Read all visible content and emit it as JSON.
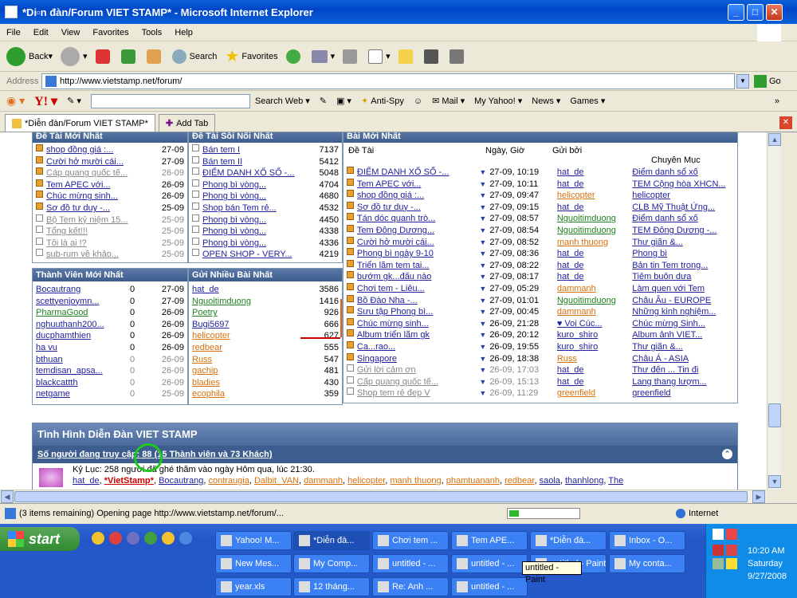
{
  "window": {
    "title": "*Di▫n đàn/Forum VIET STAMP* - Microsoft Internet Explorer"
  },
  "menu": [
    "File",
    "Edit",
    "View",
    "Favorites",
    "Tools",
    "Help"
  ],
  "toolbar": {
    "back": "Back",
    "search": "Search",
    "favorites": "Favorites"
  },
  "address": {
    "label": "Address",
    "url": "http://www.vietstamp.net/forum/",
    "go": "Go"
  },
  "yahoo": {
    "search_web": "Search Web",
    "anti_spy": "Anti-Spy",
    "mail": "Mail",
    "my_yahoo": "My Yahoo!",
    "news": "News",
    "games": "Games"
  },
  "tabs": {
    "active": "*Diễn đàn/Forum VIET STAMP*",
    "add": "Add Tab"
  },
  "panels": {
    "newest_topics": {
      "title": "Đề Tài Mới Nhất",
      "rows": [
        {
          "t": "shop đồng giá :...",
          "d": "27-09",
          "s": "o",
          "g": false
        },
        {
          "t": "Cười hở mười cái...",
          "d": "27-09",
          "s": "o",
          "g": false
        },
        {
          "t": "Cáp quang quốc tế...",
          "d": "26-09",
          "s": "o",
          "g": true
        },
        {
          "t": "Tem APEC với...",
          "d": "26-09",
          "s": "o",
          "g": false
        },
        {
          "t": "Chúc mừng sinh...",
          "d": "26-09",
          "s": "o",
          "g": false
        },
        {
          "t": "Sơ đồ tư duy -...",
          "d": "25-09",
          "s": "o",
          "g": false
        },
        {
          "t": "Bộ Tem kỷ niệm 15...",
          "d": "25-09",
          "s": "w",
          "g": true
        },
        {
          "t": "Tổng kết!!!",
          "d": "25-09",
          "s": "w",
          "g": true
        },
        {
          "t": "Tôi là ai !?",
          "d": "25-09",
          "s": "w",
          "g": true
        },
        {
          "t": "sub-rum về khảo...",
          "d": "25-09",
          "s": "w",
          "g": true
        }
      ]
    },
    "hottest_topics": {
      "title": "Đề Tài Sôi Nổi Nhất",
      "rows": [
        {
          "t": "Bán tem I",
          "n": "7137"
        },
        {
          "t": "Bán tem II",
          "n": "5412"
        },
        {
          "t": "ĐIỂM DANH XỔ SỐ -...",
          "n": "5048"
        },
        {
          "t": "Phong bì vòng...",
          "n": "4704"
        },
        {
          "t": "Phong bì vòng...",
          "n": "4680"
        },
        {
          "t": "Shop bán Tem rẻ...",
          "n": "4532"
        },
        {
          "t": "Phong bì vòng...",
          "n": "4450"
        },
        {
          "t": "Phong bì vòng...",
          "n": "4338"
        },
        {
          "t": "Phong bì vòng...",
          "n": "4336"
        },
        {
          "t": "OPEN SHOP - VERY...",
          "n": "4219"
        }
      ]
    },
    "newest_members": {
      "title": "Thành Viên Mới Nhất",
      "rows": [
        {
          "n": "Bocautrang",
          "c": "0",
          "d": "27-09",
          "cls": "lnk",
          "g": false
        },
        {
          "n": "scettyenjoymn...",
          "c": "0",
          "d": "27-09",
          "cls": "lnk",
          "g": false
        },
        {
          "n": "PharmaGood",
          "c": "0",
          "d": "26-09",
          "cls": "green",
          "g": false
        },
        {
          "n": "nghuuthanh200...",
          "c": "0",
          "d": "26-09",
          "cls": "lnk",
          "g": false
        },
        {
          "n": "ducphamthien",
          "c": "0",
          "d": "26-09",
          "cls": "lnk",
          "g": false
        },
        {
          "n": "ha vu",
          "c": "0",
          "d": "26-09",
          "cls": "lnk",
          "g": false
        },
        {
          "n": "bthuan",
          "c": "0",
          "d": "26-09",
          "cls": "lnk",
          "g": true
        },
        {
          "n": "temdisan_apsa...",
          "c": "0",
          "d": "26-09",
          "cls": "lnk",
          "g": true
        },
        {
          "n": "blackcattth",
          "c": "0",
          "d": "26-09",
          "cls": "lnk",
          "g": true
        },
        {
          "n": "netgame",
          "c": "0",
          "d": "25-09",
          "cls": "lnk",
          "g": true
        }
      ]
    },
    "top_posters": {
      "title": "Gửi Nhiều Bài Nhất",
      "rows": [
        {
          "n": "hat_de",
          "c": "3586",
          "cls": "lnk"
        },
        {
          "n": "Nguoitimduong",
          "c": "1416",
          "cls": "green"
        },
        {
          "n": "Poetry",
          "c": "926",
          "cls": "green"
        },
        {
          "n": "Bugi5697",
          "c": "666",
          "cls": "lnk"
        },
        {
          "n": "helicopter",
          "c": "627",
          "cls": "orange"
        },
        {
          "n": "redbear",
          "c": "555",
          "cls": "orange"
        },
        {
          "n": "Russ",
          "c": "547",
          "cls": "orange"
        },
        {
          "n": "gachip",
          "c": "481",
          "cls": "orange"
        },
        {
          "n": "bladies",
          "c": "430",
          "cls": "orange"
        },
        {
          "n": "ecophila",
          "c": "359",
          "cls": "orange"
        }
      ]
    },
    "newest_posts": {
      "title": "Bài Mới Nhất",
      "headers": {
        "topic": "Đề Tài",
        "date": "Ngày, Giờ",
        "by": "Gửi bởi",
        "forum": "Chuyên Mục"
      },
      "rows": [
        {
          "t": "ĐIỂM DANH XỔ SỐ -...",
          "d": "27-09, 10:19",
          "u": "hat_de",
          "uc": "lnk",
          "f": "Điểm danh sổ xố",
          "s": "o",
          "g": false
        },
        {
          "t": "Tem APEC với...",
          "d": "27-09, 10:11",
          "u": "hat_de",
          "uc": "lnk",
          "f": "TEM Cộng hòa XHCN...",
          "s": "o",
          "g": false
        },
        {
          "t": "shop đồng giá :...",
          "d": "27-09, 09:47",
          "u": "helicopter",
          "uc": "orange",
          "f": "helicopter",
          "s": "o",
          "g": false
        },
        {
          "t": "Sơ đồ tư duy -...",
          "d": "27-09, 09:15",
          "u": "hat_de",
          "uc": "lnk",
          "f": "CLB Mỹ Thuật Ứng...",
          "s": "o",
          "g": false
        },
        {
          "t": "Tán dóc quanh trò...",
          "d": "27-09, 08:57",
          "u": "Nguoitimduong",
          "uc": "green",
          "f": "Điểm danh sổ xố",
          "s": "o",
          "g": false
        },
        {
          "t": "Tem Đông Dương...",
          "d": "27-09, 08:54",
          "u": "Nguoitimduong",
          "uc": "green",
          "f": "TEM Đông Dương -...",
          "s": "o",
          "g": false
        },
        {
          "t": "Cười hở mười cái...",
          "d": "27-09, 08:52",
          "u": "manh thuong",
          "uc": "orange",
          "f": "Thư giãn &...",
          "s": "o",
          "g": false
        },
        {
          "t": "Phong bì ngày 9-10",
          "d": "27-09, 08:36",
          "u": "hat_de",
          "uc": "lnk",
          "f": "Phong bì",
          "s": "o",
          "g": false
        },
        {
          "t": "Triển lãm tem tai...",
          "d": "27-09, 08:22",
          "u": "hat_de",
          "uc": "lnk",
          "f": "Bản tin Tem trong...",
          "s": "o",
          "g": false
        },
        {
          "t": "bướm gk...đấu nào",
          "d": "27-09, 08:17",
          "u": "hat_de",
          "uc": "lnk",
          "f": "Tiêm buôn dưa",
          "s": "o",
          "g": false
        },
        {
          "t": "Chơi tem - Liêu...",
          "d": "27-09, 05:29",
          "u": "dammanh",
          "uc": "orange",
          "f": "Làm quen với Tem",
          "s": "o",
          "g": false
        },
        {
          "t": "Bồ Đào Nha -...",
          "d": "27-09, 01:01",
          "u": "Nguoitimduong",
          "uc": "green",
          "f": "Châu Âu - EUROPE",
          "s": "o",
          "g": false
        },
        {
          "t": "Sưu tập Phong bì...",
          "d": "27-09, 00:45",
          "u": "dammanh",
          "uc": "orange",
          "f": "Những kinh nghiệm...",
          "s": "o",
          "g": false
        },
        {
          "t": "Chúc mừng sinh...",
          "d": "26-09, 21:28",
          "u": "♥ Voi Cúc...",
          "uc": "lnk",
          "f": "Chúc mừng Sinh...",
          "s": "o",
          "g": false
        },
        {
          "t": "Album triển lãm gk",
          "d": "26-09, 20:12",
          "u": "kuro_shiro",
          "uc": "lnk",
          "f": "Album ảnh VIET...",
          "s": "o",
          "g": false
        },
        {
          "t": "Ca...rao...",
          "d": "26-09, 19:55",
          "u": "kuro_shiro",
          "uc": "lnk",
          "f": "Thư giãn &...",
          "s": "o",
          "g": false
        },
        {
          "t": "Singapore",
          "d": "26-09, 18:38",
          "u": "Russ",
          "uc": "orange",
          "f": "Châu Á - ASIA",
          "s": "o",
          "g": false
        },
        {
          "t": "Gửi lời cảm ơn",
          "d": "26-09, 17:03",
          "u": "hat_de",
          "uc": "lnk",
          "f": "Thư đến ... Tin đi",
          "s": "w",
          "g": true
        },
        {
          "t": "Cấp quang quốc tế...",
          "d": "26-09, 15:13",
          "u": "hat_de",
          "uc": "lnk",
          "f": "Lang thang lượm...",
          "s": "w",
          "g": true
        },
        {
          "t": "Shop tem rẻ đẹp V",
          "d": "26-09, 11:29",
          "u": "greenfield",
          "uc": "orange",
          "f": "greenfield",
          "s": "w",
          "g": true
        }
      ]
    }
  },
  "stats": {
    "title": "Tình Hình Diễn Đàn VIET STAMP",
    "online": "Số người đang truy cập: 88 (15 Thành viên và 73 Khách)",
    "record": "Kỷ Lục: 258 người đã ghé thăm vào ngày Hôm qua, lúc 21:30.",
    "users": [
      "hat_de",
      "*VietStamp*",
      "Bocautrang",
      "contraugia",
      "Dalbit_VAN",
      "dammanh",
      "helicopter",
      "manh thuong",
      "phamtuananh",
      "redbear",
      "saola",
      "thanhlong",
      "The"
    ]
  },
  "status": {
    "text": "(3 items remaining) Opening page http://www.vietstamp.net/forum/...",
    "zone": "Internet"
  },
  "taskbar": {
    "start": "start",
    "tasks": [
      "Yahoo! M...",
      "*Diễn đà...",
      "Chơi tem ...",
      "Tem APE...",
      "*Diễn đà...",
      "Inbox - O...",
      "New Mes...",
      "My Comp...",
      "untitled - ...",
      "untitled - ...",
      "untitled - Paint",
      "My conta...",
      "year.xls",
      "12 tháng...",
      "Re: Anh ...",
      "untitled - ..."
    ],
    "tooltip": "untitled - Paint"
  },
  "tray": {
    "time": "10:20 AM",
    "day": "Saturday",
    "date": "9/27/2008"
  }
}
